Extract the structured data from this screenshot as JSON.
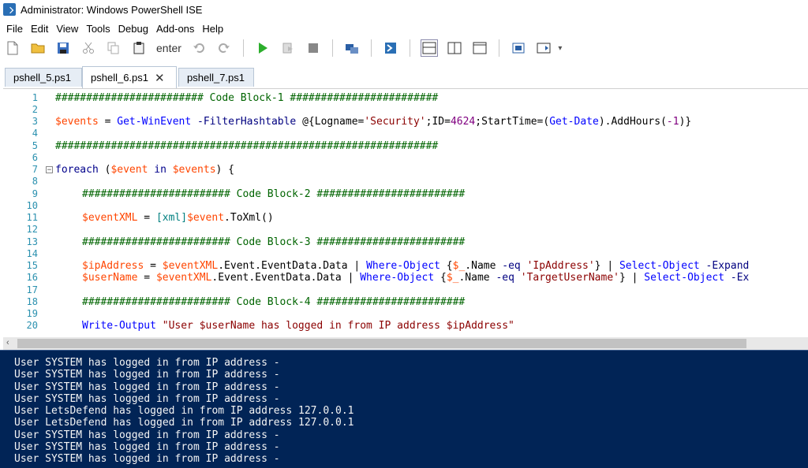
{
  "window": {
    "title": "Administrator: Windows PowerShell ISE"
  },
  "menu": [
    "File",
    "Edit",
    "View",
    "Tools",
    "Debug",
    "Add-ons",
    "Help"
  ],
  "toolbar": {
    "text_label": "enter"
  },
  "tabs": [
    {
      "label": "pshell_5.ps1",
      "active": false
    },
    {
      "label": "pshell_6.ps1",
      "active": true,
      "close": "✕"
    },
    {
      "label": "pshell_7.ps1",
      "active": false
    }
  ],
  "editor": {
    "line_numbers": [
      "1",
      "2",
      "3",
      "4",
      "5",
      "6",
      "7",
      "8",
      "9",
      "10",
      "11",
      "12",
      "13",
      "14",
      "15",
      "16",
      "17",
      "18",
      "19",
      "20"
    ],
    "lines": {
      "l1": "######################## Code Block-1 ########################",
      "l3": {
        "var": "$events",
        "eq": " = ",
        "cmd": "Get-WinEvent",
        "param": " -FilterHashtable",
        "rest1": " @{Logname=",
        "str": "'Security'",
        "rest2": ";ID=",
        "num": "4624",
        "rest3": ";StartTime=(",
        "cmd2": "Get-Date",
        "rest4": ").AddHours(",
        "num2": "-1",
        "rest5": ")}"
      },
      "l5": "##############################################################",
      "l7": {
        "kw": "foreach",
        "rest1": " (",
        "var1": "$event",
        "kw2": " in ",
        "var2": "$events",
        "rest2": ") {"
      },
      "l9": "######################## Code Block-2 ########################",
      "l11": {
        "var": "$eventXML",
        "eq": " = ",
        "type": "[xml]",
        "var2": "$event",
        "rest": ".ToXml()"
      },
      "l13": "######################## Code Block-3 ########################",
      "l15": {
        "var": "$ipAddress",
        "eq": " = ",
        "var2": "$eventXML",
        "rest1": ".Event.EventData.Data | ",
        "cmd": "Where-Object",
        "rest2": " {",
        "var3": "$_",
        "rest3": ".Name ",
        "param": "-eq",
        "str": " 'IpAddress'",
        "rest4": "} | ",
        "cmd2": "Select-Object",
        "param2": " -Expand"
      },
      "l16": {
        "var": "$userName",
        "eq": " = ",
        "var2": "$eventXML",
        "rest1": ".Event.EventData.Data | ",
        "cmd": "Where-Object",
        "rest2": " {",
        "var3": "$_",
        "rest3": ".Name ",
        "param": "-eq",
        "str": " 'TargetUserName'",
        "rest4": "} | ",
        "cmd2": "Select-Object",
        "param2": " -Ex"
      },
      "l18": "######################## Code Block-4 ########################",
      "l20": {
        "cmd": "Write-Output",
        "str": " \"User $userName has logged in from IP address $ipAddress\""
      }
    }
  },
  "console": {
    "lines": [
      "User SYSTEM has logged in from IP address -",
      "User SYSTEM has logged in from IP address -",
      "User SYSTEM has logged in from IP address -",
      "User SYSTEM has logged in from IP address -",
      "User LetsDefend has logged in from IP address 127.0.0.1",
      "User LetsDefend has logged in from IP address 127.0.0.1",
      "User SYSTEM has logged in from IP address -",
      "User SYSTEM has logged in from IP address -",
      "User SYSTEM has logged in from IP address -"
    ]
  }
}
